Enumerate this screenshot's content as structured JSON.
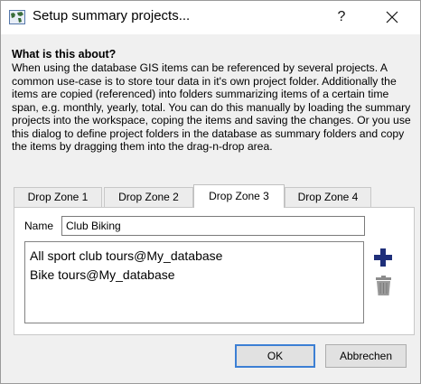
{
  "window": {
    "title": "Setup summary projects...",
    "help_label": "?",
    "close_label": "✕"
  },
  "info": {
    "heading": "What is this about?",
    "description": "When using the database GIS items can be referenced by several projects. A common use-case is to store tour data in it's own project folder. Additionally the items are copied (referenced) into folders summarizing items of a certain time span, e.g. monthly, yearly, total. You can do this manually by loading the summary projects into the workspace, coping the items and saving the changes. Or you use this dialog to define project folders in the database as summary folders and copy the items by dragging them into the drag-n-drop area."
  },
  "tabs": [
    {
      "label": "Drop Zone 1",
      "active": false
    },
    {
      "label": "Drop Zone 2",
      "active": false
    },
    {
      "label": "Drop Zone 3",
      "active": true
    },
    {
      "label": "Drop Zone 4",
      "active": false
    }
  ],
  "drop_zone": {
    "name_label": "Name",
    "name_value": "Club Biking",
    "items": [
      "All sport club tours@My_database",
      "Bike tours@My_database"
    ],
    "add_icon": "plus-icon",
    "remove_icon": "trash-icon"
  },
  "buttons": {
    "ok": "OK",
    "cancel": "Abbrechen"
  },
  "colors": {
    "accent": "#3c7fd4",
    "plus": "#1f2f7a"
  }
}
